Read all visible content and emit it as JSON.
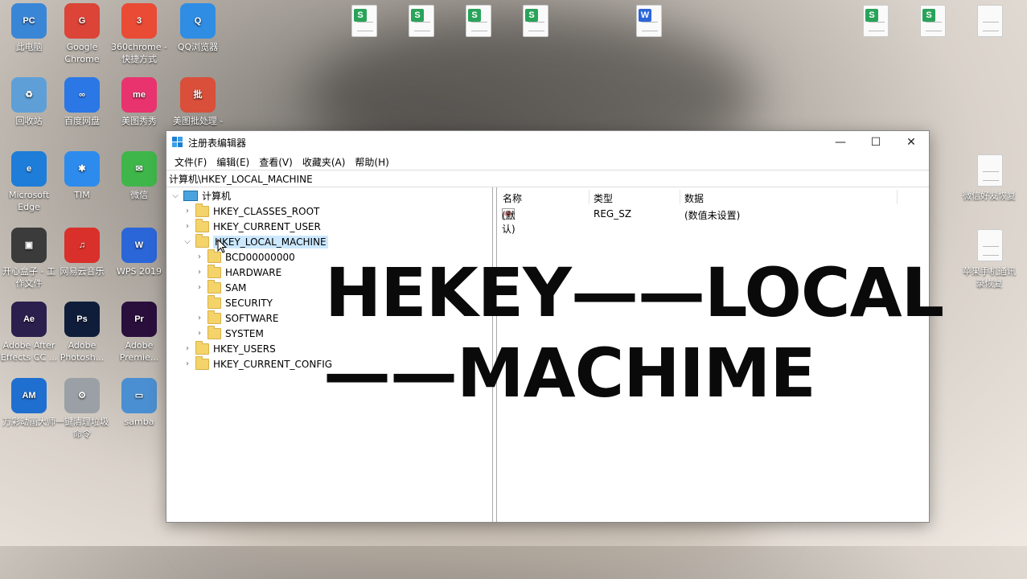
{
  "desktop": {
    "icons": [
      {
        "name": "this-pc",
        "label": "此电脑",
        "color": "#3a86d6",
        "glyph": "PC"
      },
      {
        "name": "chrome",
        "label": "Google Chrome",
        "color": "#db4437",
        "glyph": "G"
      },
      {
        "name": "360chrome",
        "label": "360chrome - 快捷方式",
        "color": "#e94b35",
        "glyph": "3"
      },
      {
        "name": "qq-browser",
        "label": "QQ浏览器",
        "color": "#2f8de4",
        "glyph": "Q"
      },
      {
        "name": "recycle-bin",
        "label": "回收站",
        "color": "#5e9fd8",
        "glyph": "♻"
      },
      {
        "name": "baidu-netdisk",
        "label": "百度网盘",
        "color": "#2b77e6",
        "glyph": "∞"
      },
      {
        "name": "meitu",
        "label": "美图秀秀",
        "color": "#e8336f",
        "glyph": "me"
      },
      {
        "name": "meitu-batch",
        "label": "美图批处理 -",
        "color": "#d94f3a",
        "glyph": "批"
      },
      {
        "name": "edge",
        "label": "Microsoft Edge",
        "color": "#1e7dd8",
        "glyph": "e"
      },
      {
        "name": "tim",
        "label": "TIM",
        "color": "#2d8bed",
        "glyph": "✱"
      },
      {
        "name": "wechat",
        "label": "微信",
        "color": "#3fb64a",
        "glyph": "✉"
      },
      {
        "name": "kaixin",
        "label": "开心盒子 - 工作文件",
        "color": "#3b3b3b",
        "glyph": "▣"
      },
      {
        "name": "netease-music",
        "label": "网易云音乐",
        "color": "#d9302b",
        "glyph": "♫"
      },
      {
        "name": "wps",
        "label": "WPS 2019",
        "color": "#2b66d9",
        "glyph": "W"
      },
      {
        "name": "after-effects",
        "label": "Adobe After Effects CC ...",
        "color": "#2b1f4d",
        "glyph": "Ae"
      },
      {
        "name": "photoshop",
        "label": "Adobe Photosh...",
        "color": "#0f1d3a",
        "glyph": "Ps"
      },
      {
        "name": "premiere",
        "label": "Adobe Premie...",
        "color": "#2a0f3d",
        "glyph": "Pr"
      },
      {
        "name": "am",
        "label": "万彩动画大师",
        "color": "#1f6fd0",
        "glyph": "AM"
      },
      {
        "name": "cleanup",
        "label": "一键清理垃圾命令",
        "color": "#9aa0a6",
        "glyph": "⚙"
      },
      {
        "name": "samba",
        "label": "samba",
        "color": "#4a8fd1",
        "glyph": "▭"
      }
    ],
    "right_files": [
      {
        "label": "微信好友恢复"
      },
      {
        "label": "苹果手机通讯录恢复"
      }
    ]
  },
  "window": {
    "title": "注册表编辑器",
    "minimize": "—",
    "maximize": "☐",
    "close": "✕",
    "menu": [
      "文件(F)",
      "编辑(E)",
      "查看(V)",
      "收藏夹(A)",
      "帮助(H)"
    ],
    "address": "计算机\\HKEY_LOCAL_MACHINE",
    "tree": {
      "root": "计算机",
      "hkcr": "HKEY_CLASSES_ROOT",
      "hkcu": "HKEY_CURRENT_USER",
      "hklm": "HKEY_LOCAL_MACHINE",
      "bcd": "BCD00000000",
      "hardware": "HARDWARE",
      "sam": "SAM",
      "security": "SECURITY",
      "software": "SOFTWARE",
      "system": "SYSTEM",
      "hku": "HKEY_USERS",
      "hkcc": "HKEY_CURRENT_CONFIG"
    },
    "columns": {
      "name": "名称",
      "type": "类型",
      "data": "数据"
    },
    "value_row": {
      "name": "(默认)",
      "type": "REG_SZ",
      "data": "(数值未设置)"
    }
  },
  "overlay": {
    "line1": "HEKEY——LOCAL",
    "line2": "——MACHIME"
  }
}
